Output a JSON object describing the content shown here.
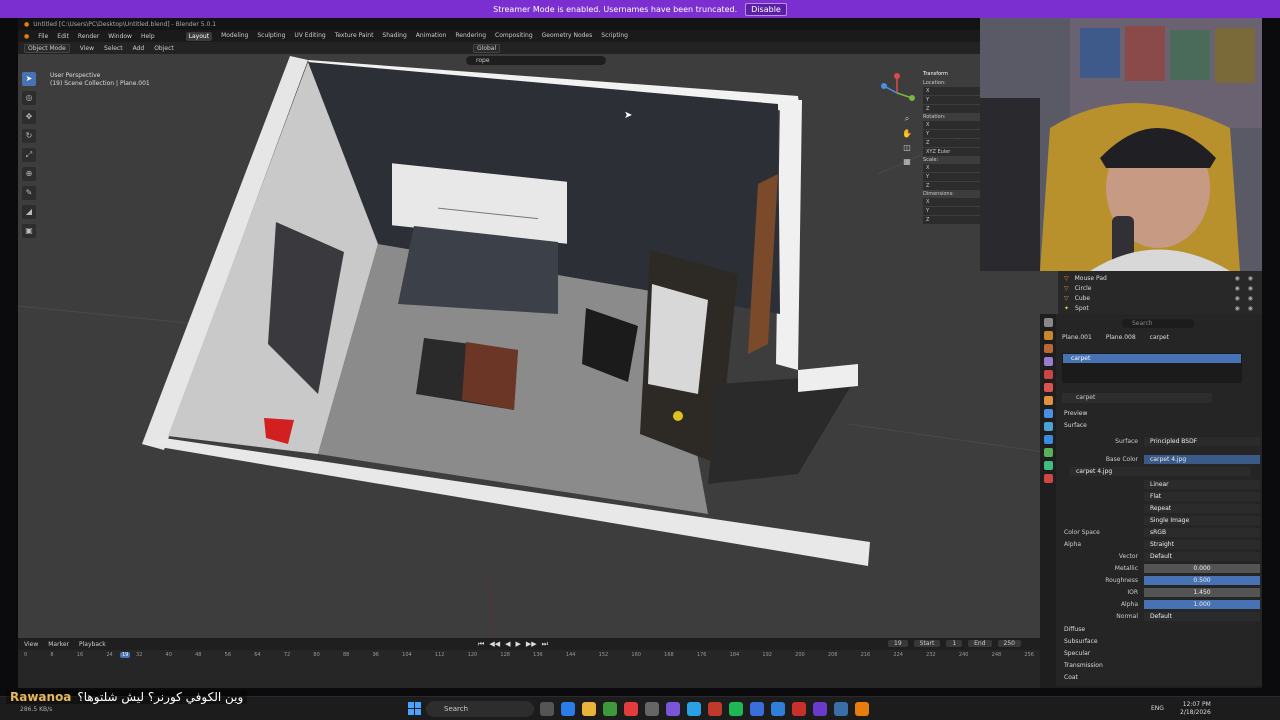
{
  "banner": {
    "text": "Streamer Mode is enabled. Usernames have been truncated.",
    "button": "Disable"
  },
  "window": {
    "title": "Untitled [C:\\Users\\PC\\Desktop\\Untitled.blend] - Blender 5.0.1"
  },
  "menu": {
    "items": [
      "File",
      "Edit",
      "Render",
      "Window",
      "Help"
    ],
    "workspaces": [
      "Layout",
      "Modeling",
      "Sculpting",
      "UV Editing",
      "Texture Paint",
      "Shading",
      "Animation",
      "Rendering",
      "Compositing",
      "Geometry Nodes",
      "Scripting"
    ],
    "active_workspace": "Layout"
  },
  "viewport_header": {
    "mode": "Object Mode",
    "menus": [
      "View",
      "Select",
      "Add",
      "Object"
    ],
    "orientation": "Global"
  },
  "viewport": {
    "search_value": "rope",
    "view_label": "User Perspective",
    "collection_label": "(19) Scene Collection | Plane.001"
  },
  "npanel": {
    "transform": "Transform",
    "location": "Location:",
    "rotation": "Rotation:",
    "mode": "XYZ Euler",
    "scale": "Scale:",
    "dimensions": "Dimensions:",
    "axes": [
      "X",
      "Y",
      "Z"
    ]
  },
  "outliner": {
    "rows": [
      {
        "name": "Mouse Pad"
      },
      {
        "name": "Circle"
      },
      {
        "name": "Cube"
      },
      {
        "name": "Spot"
      }
    ]
  },
  "properties": {
    "search_placeholder": "Search",
    "breadcrumb": [
      "Plane.001",
      "Plane.008",
      "carpet"
    ],
    "slot_selected": "carpet",
    "material_name": "carpet",
    "preview": "Preview",
    "surface_section": "Surface",
    "surface": {
      "label": "Surface",
      "value": "Principled BSDF"
    },
    "base_color": {
      "label": "Base Color",
      "value": "carpet 4.jpg"
    },
    "image_name": "carpet 4.jpg",
    "image_opts": [
      "Linear",
      "Flat",
      "Repeat",
      "Single Image"
    ],
    "color_space": {
      "label": "Color Space",
      "value": "sRGB"
    },
    "alpha_mode": {
      "label": "Alpha",
      "value": "Straight"
    },
    "vector": {
      "label": "Vector",
      "value": "Default"
    },
    "metallic": {
      "label": "Metallic",
      "value": "0.000"
    },
    "roughness": {
      "label": "Roughness",
      "value": "0.500"
    },
    "ior": {
      "label": "IOR",
      "value": "1.450"
    },
    "alpha": {
      "label": "Alpha",
      "value": "1.000"
    },
    "normal": {
      "label": "Normal",
      "value": "Default"
    },
    "subpanels": [
      "Diffuse",
      "Subsurface",
      "Specular",
      "Transmission",
      "Coat"
    ]
  },
  "timeline": {
    "menus": [
      "View",
      "Marker",
      "Playback"
    ],
    "ticks": [
      "0",
      "8",
      "16",
      "24",
      "32",
      "40",
      "48",
      "56",
      "64",
      "72",
      "80",
      "88",
      "96",
      "104",
      "112",
      "120",
      "128",
      "136",
      "144",
      "152",
      "160",
      "168",
      "176",
      "184",
      "192",
      "200",
      "208",
      "216",
      "224",
      "232",
      "240",
      "248",
      "256"
    ],
    "current_frame": "19",
    "start_label": "Start",
    "start": "1",
    "end_label": "End",
    "end": "250"
  },
  "chat": {
    "user": "Rawanoa",
    "message": "وين الكوفي كورنر؟ ليش شلتوها؟"
  },
  "status": {
    "rate": "286.5 KB/s"
  },
  "taskbar": {
    "search": "Search",
    "lang": "ENG",
    "time": "12:07 PM",
    "date": "2/18/2026"
  },
  "colors": {
    "accent": "#4772b3",
    "banner": "#7b2fd1",
    "guitar": "#d21f1f"
  }
}
